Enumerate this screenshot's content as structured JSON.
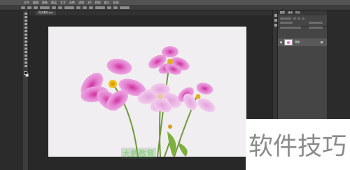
{
  "app": {
    "logo": "Ps"
  },
  "menu": [
    "文件",
    "编辑",
    "图像",
    "图层",
    "文字",
    "选择",
    "滤镜",
    "3D",
    "视图",
    "窗口",
    "帮助"
  ],
  "document": {
    "tab_title": "花卉素材.jpg"
  },
  "watermark": "大鹏教育",
  "layers_panel": {
    "tabs": [
      "图层",
      "通道",
      "路径"
    ],
    "layer_name": "背景"
  },
  "brand": "软件技巧",
  "colors": {
    "flower": "#e070c8",
    "watermark": "#7bd06e",
    "canvas_bg": "#f1eef1",
    "ui_dark": "#282828"
  }
}
